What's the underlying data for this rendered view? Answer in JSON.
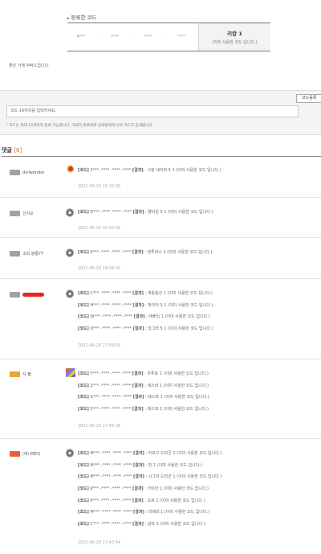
{
  "registered": {
    "title": "등록한 코드",
    "codes": [
      "4***",
      "****",
      "****",
      "****"
    ],
    "status_title": "키캉 1",
    "status_sub": "(이미 사용한 코드 입니다.)"
  },
  "thanks": "좋은 거래 부탁드립니다.",
  "register_button": "코드등록",
  "input_placeholder": "코드 16자리를 입력하세요.",
  "note": "! 코드는 최대 10개까지 등록 가능합니다. 거래가 완료되면 상대방에게 나의 코드가 공개됩니다.",
  "comments_header": {
    "label": "댓글",
    "count": "[6]"
  },
  "comments": [
    {
      "level": "",
      "nick": "dvilwonder",
      "avatar": "bird",
      "date": "2021-08-30 15:22:29",
      "lines": [
        {
          "pre": "2*** -**** -**** -****",
          "res": ": 그랑 세이버 5 1 (이미 사용한 코드 입니다.)"
        }
      ]
    },
    {
      "level": "",
      "nick": "신지오",
      "avatar": "gray",
      "date": "2021-08-30 01:56:09",
      "lines": [
        {
          "pre": "D*** -**** -**** -****",
          "res": ": 헬리온 5 1 (이미 사용한 코드 입니다.)"
        }
      ]
    },
    {
      "level": "",
      "nick": "소피 왕롱YT",
      "avatar": "gray",
      "date": "2021-08-29 18:09:35",
      "lines": [
        {
          "pre": "6*** -**** -**** -****",
          "res": ": 엔투라스 1 (이미 사용한 코드 입니다.)"
        }
      ]
    },
    {
      "level": "",
      "nick": "",
      "redacted": true,
      "avatar": "gray",
      "date": "2021-08-29 17:59:58",
      "lines": [
        {
          "pre": "C*** -**** -**** -****",
          "res": ": 개틀링건 1 (이미 사용한 코드 입니다.)"
        },
        {
          "pre": "H*** -**** -**** -****",
          "res": ": 파이어 5 1 (이미 사용한 코드 입니다.)"
        },
        {
          "pre": "W*** -**** -**** -****",
          "res": ": 애플릭 1 (이미 사용한 코드 입니다.)"
        },
        {
          "pre": "D*** -**** -**** -****",
          "res": ": 앙그라 5 1 (이미 사용한 코드 입니다.)"
        }
      ]
    },
    {
      "level": "orange",
      "nick": "샤 블",
      "avatar": "mix",
      "date": "2021-08-29 17:44:38",
      "lines": [
        {
          "pre": "Y*** -**** -**** -****",
          "res": ": 우투토 1 (이미 사용한 코드 입니다.)"
        },
        {
          "pre": "2*** -**** -**** -****",
          "res": ": 테스락 1 (이미 사용한 코드 입니다.)"
        },
        {
          "pre": "G*** -**** -**** -****",
          "res": ": 테스락 1 (이미 사용한 코드 입니다.)"
        },
        {
          "pre": "5*** -**** -**** -****",
          "res": ": 테스락 1 (이미 사용한 코드 입니다.)"
        }
      ]
    },
    {
      "level": "red",
      "nick": "(애니메라)",
      "avatar": "gray",
      "date": "2021-08-29 17:43:44",
      "lines": [
        {
          "pre": "M*** -**** -**** -****",
          "res": ": 아르고 드라군 1 (이미 사용한 코드 입니다.)"
        },
        {
          "pre": "M*** -**** -**** -****",
          "res": ": 찬 1 (이미 사용한 코드 입니다.)"
        },
        {
          "pre": "M*** -**** -**** -****",
          "res": ": 시그마 드라군 1 (이미 사용한 코드 입니다.)"
        },
        {
          "pre": "K*** -**** -**** -****",
          "res": ": 가이안 1 (이미 사용한 코드 입니다.)"
        },
        {
          "pre": "K*** -**** -**** -****",
          "res": ": 오르 1 (이미 사용한 코드 입니다.)"
        },
        {
          "pre": "M*** -**** -**** -****",
          "res": ": 리베라 1 (이미 사용한 코드 입니다.)"
        },
        {
          "pre": "C*** -**** -**** -****",
          "res": ": 샬라 1 (이미 사용한 코드 입니다.)"
        }
      ]
    }
  ],
  "labels": {
    "code_tag": "[코드]",
    "result_tag": "[결과]"
  }
}
